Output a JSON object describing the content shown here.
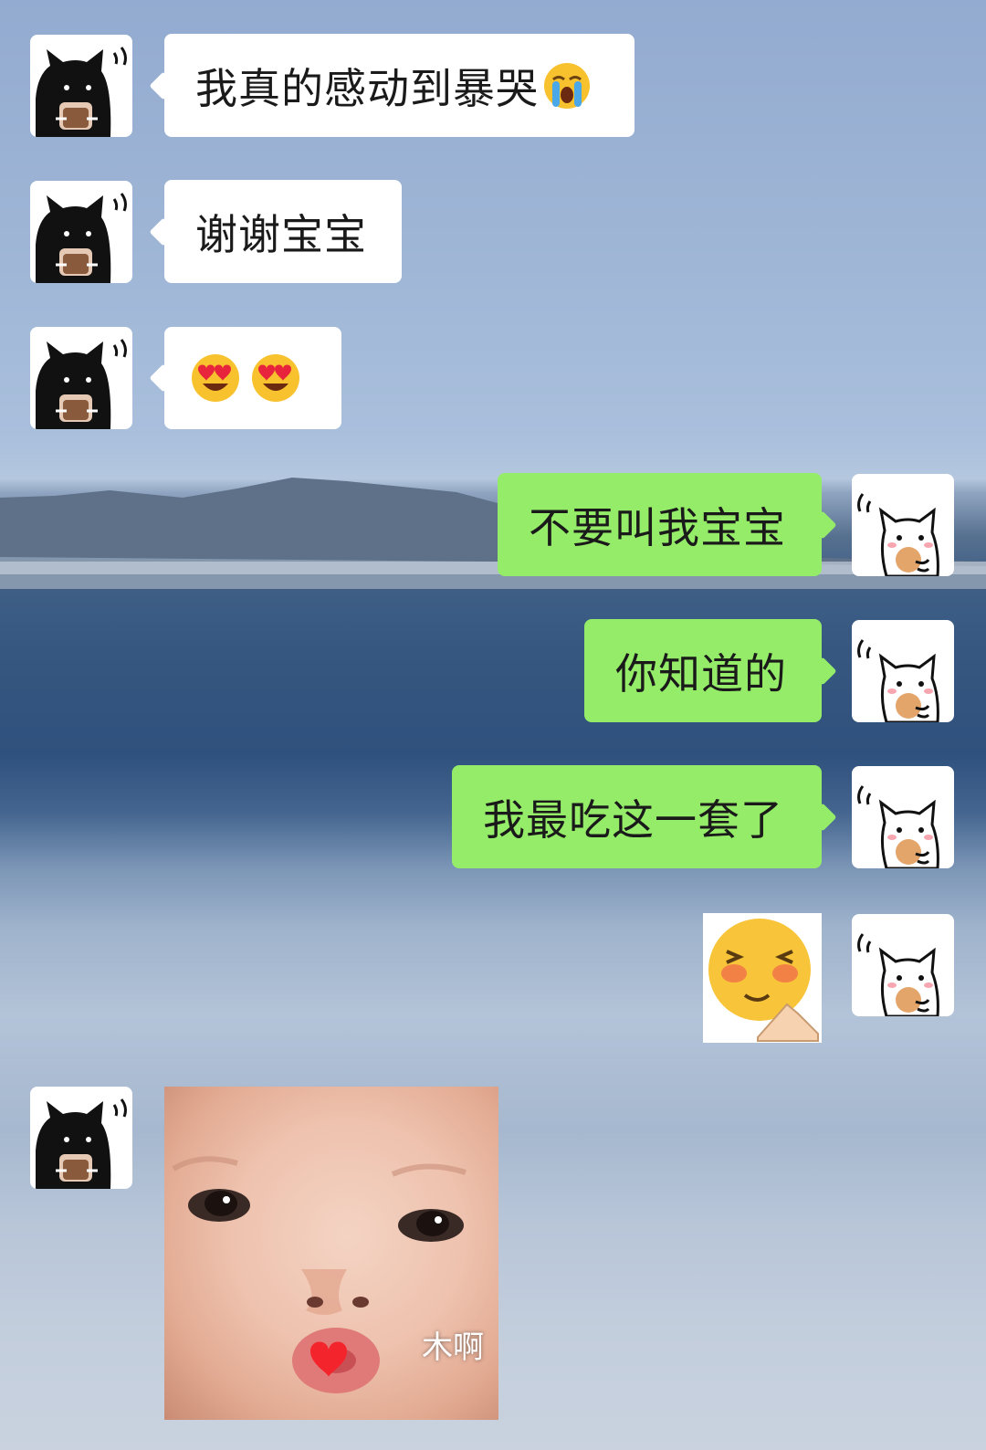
{
  "chat": {
    "messages": [
      {
        "side": "left",
        "type": "text",
        "text": "我真的感动到暴哭",
        "emoji": "loudly-crying-face"
      },
      {
        "side": "left",
        "type": "text",
        "text": "谢谢宝宝"
      },
      {
        "side": "left",
        "type": "emoji",
        "emoji": [
          "smiling-face-with-heart-eyes",
          "smiling-face-with-heart-eyes"
        ]
      },
      {
        "side": "right",
        "type": "text",
        "text": "不要叫我宝宝"
      },
      {
        "side": "right",
        "type": "text",
        "text": "你知道的"
      },
      {
        "side": "right",
        "type": "text",
        "text": "我最吃这一套了"
      },
      {
        "side": "right",
        "type": "sticker",
        "sticker": "shy-blushing-face-sticker"
      },
      {
        "side": "left",
        "type": "image",
        "caption": "木啊"
      }
    ]
  },
  "avatars": {
    "left": "black-cat-with-cup-avatar",
    "right": "white-cat-with-cookie-avatar"
  },
  "colors": {
    "incoming_bubble": "#ffffff",
    "outgoing_bubble": "#95ec69",
    "text": "#1a1a1a"
  }
}
